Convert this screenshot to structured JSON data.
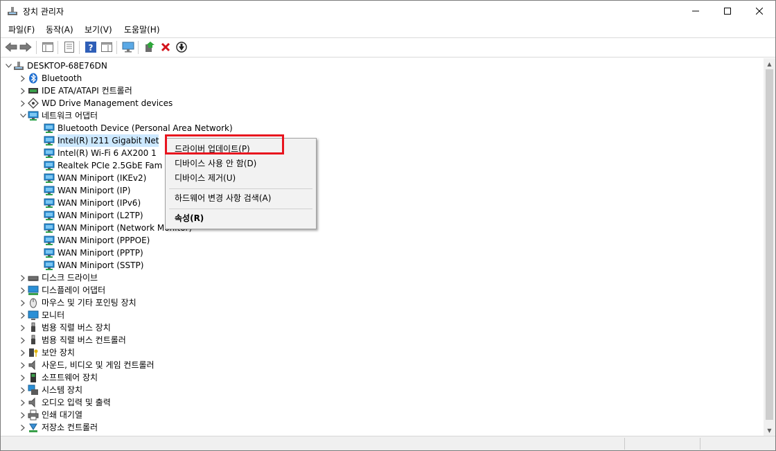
{
  "window": {
    "title": "장치 관리자",
    "minimize": "—",
    "maximize": "☐",
    "close": "✕"
  },
  "menu": [
    "파일(F)",
    "동작(A)",
    "보기(V)",
    "도움말(H)"
  ],
  "toolbar_icons": [
    "back-icon",
    "forward-icon",
    "show-hide-tree-icon",
    "properties-icon",
    "help-icon",
    "action-pane-icon",
    "monitor-scan-icon",
    "update-driver-icon",
    "uninstall-icon",
    "disable-icon"
  ],
  "tree": {
    "root": "DESKTOP-68E76DN",
    "categories_top": [
      {
        "label": "Bluetooth",
        "icon": "bluetooth-icon"
      },
      {
        "label": "IDE ATA/ATAPI 컨트롤러",
        "icon": "ide-controller-icon"
      },
      {
        "label": "WD Drive Management devices",
        "icon": "wd-drive-icon"
      }
    ],
    "network": {
      "label": "네트워크 어댑터",
      "children": [
        "Bluetooth Device (Personal Area Network)",
        "Intel(R) I211 Gigabit Net",
        "Intel(R) Wi-Fi 6 AX200 1",
        "Realtek PCIe 2.5GbE Fam",
        "WAN Miniport (IKEv2)",
        "WAN Miniport (IP)",
        "WAN Miniport (IPv6)",
        "WAN Miniport (L2TP)",
        "WAN Miniport (Network Monitor)",
        "WAN Miniport (PPPOE)",
        "WAN Miniport (PPTP)",
        "WAN Miniport (SSTP)"
      ]
    },
    "categories_bottom": [
      {
        "label": "디스크 드라이브",
        "icon": "disk-drive-icon"
      },
      {
        "label": "디스플레이 어댑터",
        "icon": "display-adapter-icon"
      },
      {
        "label": "마우스 및 기타 포인팅 장치",
        "icon": "mouse-icon"
      },
      {
        "label": "모니터",
        "icon": "monitor-icon"
      },
      {
        "label": "범용 직렬 버스 장치",
        "icon": "usb-icon"
      },
      {
        "label": "범용 직렬 버스 컨트롤러",
        "icon": "usb-icon"
      },
      {
        "label": "보안 장치",
        "icon": "security-device-icon"
      },
      {
        "label": "사운드, 비디오 및 게임 컨트롤러",
        "icon": "speaker-icon"
      },
      {
        "label": "소프트웨어 장치",
        "icon": "software-device-icon"
      },
      {
        "label": "시스템 장치",
        "icon": "system-device-icon"
      },
      {
        "label": "오디오 입력 및 출력",
        "icon": "speaker-icon"
      },
      {
        "label": "인쇄 대기열",
        "icon": "printer-icon"
      },
      {
        "label": "저장소 컨트롤러",
        "icon": "storage-controller-icon"
      }
    ]
  },
  "context_menu": {
    "update_driver": "드라이버 업데이트(P)",
    "disable_device": "디바이스 사용 안 함(D)",
    "uninstall_device": "디바이스 제거(U)",
    "scan_hardware": "하드웨어 변경 사항 검색(A)",
    "properties": "속성(R)"
  },
  "colors": {
    "highlight_box": "#e8141e",
    "selection": "#cce8ff",
    "network_icon": "#2a8fd6"
  }
}
